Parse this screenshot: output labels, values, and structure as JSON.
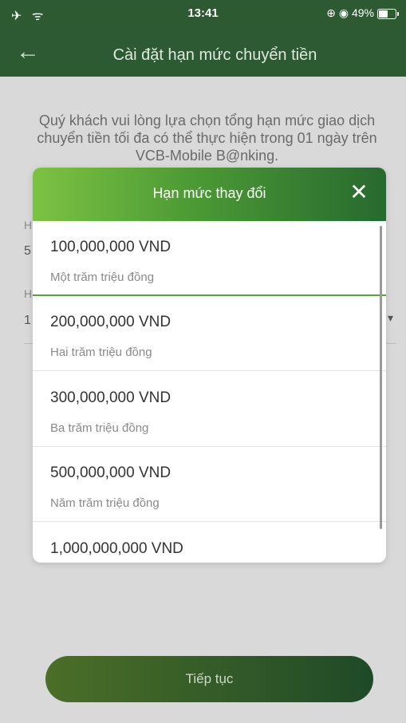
{
  "status": {
    "time": "13:41",
    "battery": "49%",
    "icons": [
      "airplane-icon",
      "wifi-icon",
      "lock-rotation-icon",
      "alarm-icon"
    ]
  },
  "nav": {
    "title": "Cài đặt hạn mức chuyển tiền",
    "back": "←"
  },
  "content": {
    "intro": "Quý khách vui lòng lựa chọn tổng hạn mức giao dịch chuyển tiền tối đa có thể thực hiện trong 01 ngày trên VCB-Mobile B@nking.",
    "field1_label": "H",
    "field1_value": "5",
    "field2_label": "H",
    "field2_value": "1",
    "continue": "Tiếp tục"
  },
  "modal": {
    "title": "Hạn mức thay đổi",
    "close": "✕",
    "options": [
      {
        "amount": "100,000,000 VND",
        "words": "Một trăm triệu đồng"
      },
      {
        "amount": "200,000,000 VND",
        "words": "Hai trăm triệu đồng"
      },
      {
        "amount": "300,000,000 VND",
        "words": "Ba trăm triệu đồng"
      },
      {
        "amount": "500,000,000 VND",
        "words": "Năm trăm triệu đồng"
      },
      {
        "amount": "1,000,000,000 VND",
        "words": ""
      }
    ],
    "selected_index": 0
  },
  "colors": {
    "header": "#2c5a31",
    "accent": "#5aa33a",
    "modal_gradient_start": "#7cc243",
    "modal_gradient_end": "#27692f"
  }
}
